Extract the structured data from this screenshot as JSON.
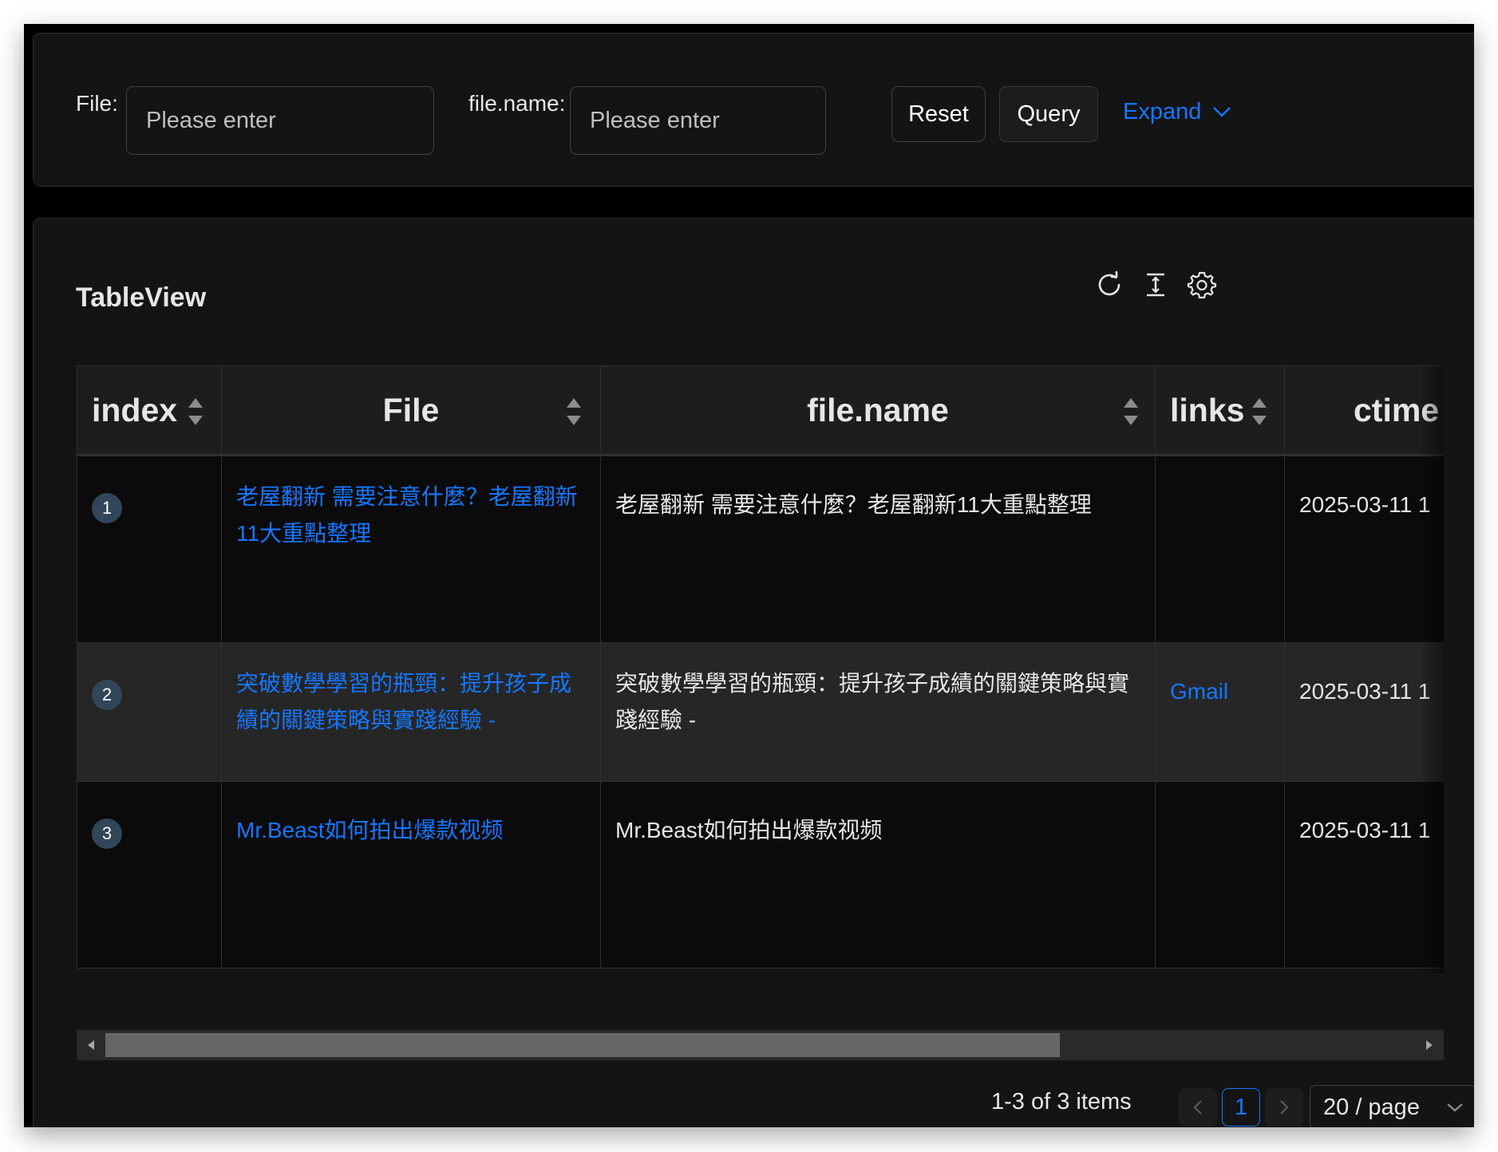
{
  "search": {
    "file_label": "File",
    "file_placeholder": "Please enter",
    "filename_label": "file.name",
    "filename_placeholder": "Please enter",
    "reset_label": "Reset",
    "query_label": "Query",
    "expand_label": "Expand"
  },
  "table": {
    "title": "TableView",
    "toolbar": {
      "reload_icon": "reload-icon",
      "density_icon": "column-height-icon",
      "settings_icon": "setting-icon"
    },
    "columns": [
      {
        "label": "index",
        "sortable": true
      },
      {
        "label": "File",
        "sortable": true
      },
      {
        "label": "file.name",
        "sortable": true
      },
      {
        "label": "links",
        "sortable": true
      },
      {
        "label": "ctime",
        "sortable": false
      }
    ],
    "rows": [
      {
        "index": "1",
        "file": "老屋翻新 需要注意什麼？老屋翻新11大重點整理",
        "file_name": "老屋翻新 需要注意什麼？老屋翻新11大重點整理",
        "links": "",
        "ctime": "2025-03-11 1"
      },
      {
        "index": "2",
        "file": "突破數學學習的瓶頸：提升孩子成績的關鍵策略與實踐經驗 -",
        "file_name": "突破數學學習的瓶頸：提升孩子成績的關鍵策略與實踐經驗 -",
        "links": "Gmail",
        "ctime": "2025-03-11 1"
      },
      {
        "index": "3",
        "file": "Mr.Beast如何拍出爆款视频",
        "file_name": "Mr.Beast如何拍出爆款视频",
        "links": "",
        "ctime": "2025-03-11 1"
      }
    ]
  },
  "pagination": {
    "total_text": "1-3 of 3 items",
    "current_page": "1",
    "page_size": "20 / page"
  },
  "colors": {
    "accent": "#1677ff",
    "background": "#141414",
    "row_highlight": "#262626",
    "index_badge": "#314659"
  }
}
